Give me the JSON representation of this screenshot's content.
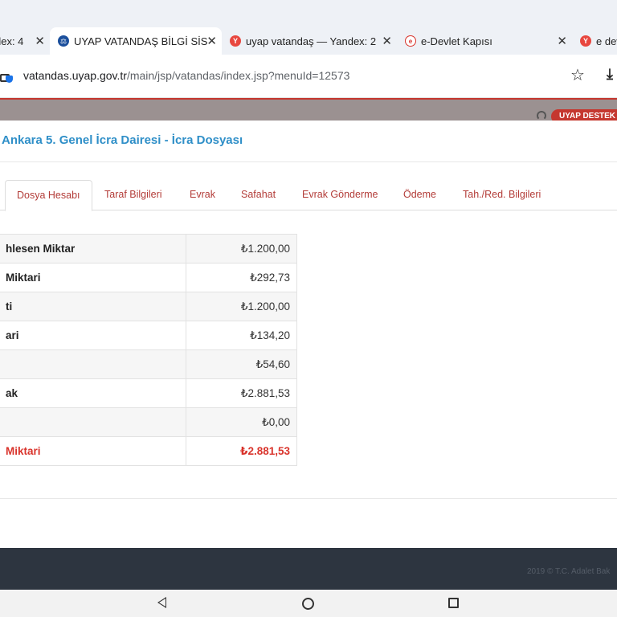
{
  "browser": {
    "tabs": [
      {
        "title": "dex: 4",
        "favicon": "yandex-icon",
        "favicon_color": "#e8473f",
        "active": false
      },
      {
        "title": "UYAP VATANDAŞ BİLGİ SİS",
        "favicon": "uyap-icon",
        "favicon_color": "#1b4f9c",
        "active": true
      },
      {
        "title": "uyap vatandaş — Yandex: 2",
        "favicon": "yandex-icon",
        "favicon_color": "#e8473f",
        "active": false
      },
      {
        "title": "e-Devlet Kapısı",
        "favicon": "edevlet-icon",
        "favicon_color": "#d9332b",
        "active": false
      },
      {
        "title": "e dev",
        "favicon": "yandex-icon",
        "favicon_color": "#e8473f",
        "active": false
      }
    ],
    "url_host": "vatandas.uyap.gov.tr",
    "url_path": "/main/jsp/vatandas/index.jsp?menuId=12573"
  },
  "site": {
    "support_label": "UYAP DESTEK"
  },
  "modal": {
    "title": "Ankara 5. Genel İcra Dairesi - İcra Dosyası",
    "tabs": [
      {
        "label": "Dosya Hesabı",
        "active": true
      },
      {
        "label": "Taraf Bilgileri",
        "active": false
      },
      {
        "label": "Evrak",
        "active": false
      },
      {
        "label": "Safahat",
        "active": false
      },
      {
        "label": "Evrak Gönderme",
        "active": false
      },
      {
        "label": "Ödeme",
        "active": false
      },
      {
        "label": "Tah./Red. Bilgileri",
        "active": false
      }
    ],
    "rows": [
      {
        "label": "hlesen Miktar",
        "value": "₺1.200,00"
      },
      {
        "label": "Miktari",
        "value": "₺292,73"
      },
      {
        "label": "ti",
        "value": "₺1.200,00"
      },
      {
        "label": "ari",
        "value": "₺134,20"
      },
      {
        "label": "",
        "value": "₺54,60"
      },
      {
        "label": "ak",
        "value": "₺2.881,53"
      },
      {
        "label": "",
        "value": "₺0,00"
      },
      {
        "label": "Miktari",
        "value": "₺2.881,53"
      }
    ]
  },
  "footer": {
    "copyright": "2019 © T.C. Adalet Bak"
  },
  "colors": {
    "accent_red": "#c5372f",
    "title_blue": "#2f8fc8",
    "total_red": "#d9332b"
  }
}
